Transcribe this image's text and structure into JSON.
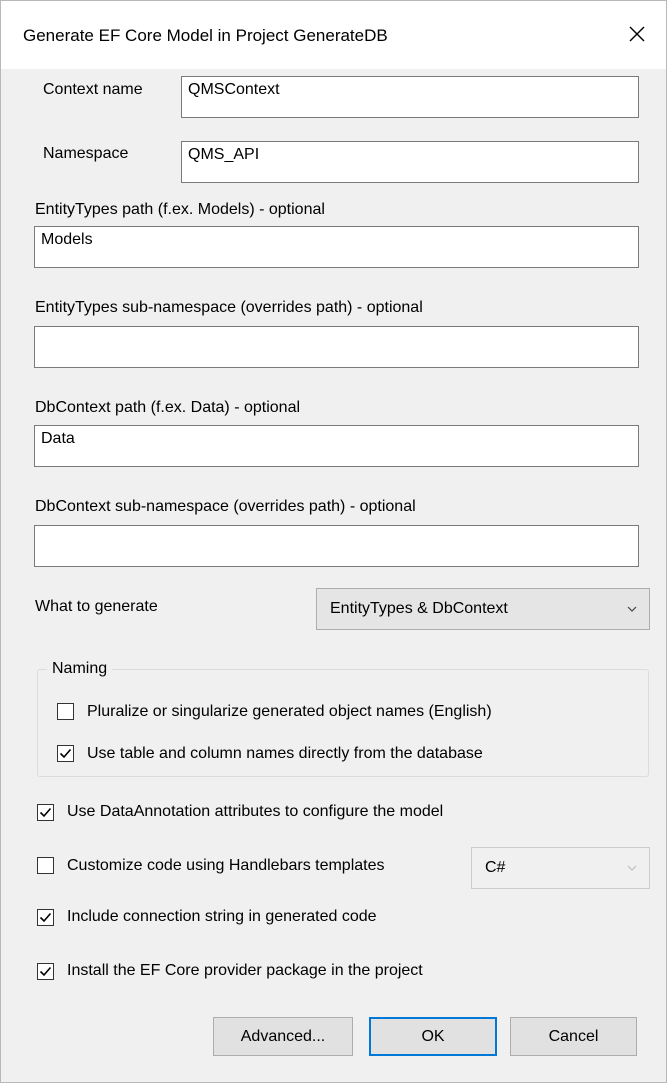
{
  "dialog": {
    "title": "Generate EF Core Model in Project GenerateDB"
  },
  "fields": {
    "context_name": {
      "label": "Context name",
      "value": "QMSContext"
    },
    "namespace": {
      "label": "Namespace",
      "value": "QMS_API"
    },
    "entity_types_path": {
      "label": "EntityTypes path (f.ex. Models) - optional",
      "value": "Models"
    },
    "entity_types_subnamespace": {
      "label": "EntityTypes sub-namespace (overrides path) - optional",
      "value": ""
    },
    "dbcontext_path": {
      "label": "DbContext path (f.ex. Data) - optional",
      "value": "Data"
    },
    "dbcontext_subnamespace": {
      "label": "DbContext sub-namespace (overrides path) - optional",
      "value": ""
    }
  },
  "what_to_generate": {
    "label": "What to generate",
    "selected": "EntityTypes & DbContext"
  },
  "naming": {
    "legend": "Naming",
    "pluralize": {
      "label": "Pluralize or singularize generated object names (English)",
      "checked": false
    },
    "use_db_names": {
      "label": "Use table and column names directly from the database",
      "checked": true
    }
  },
  "options": {
    "data_annotations": {
      "label": "Use DataAnnotation attributes to configure the model",
      "checked": true
    },
    "handlebars": {
      "label": "Customize code using Handlebars templates",
      "checked": false,
      "language": "C#"
    },
    "connection_string": {
      "label": "Include connection string in generated code",
      "checked": true
    },
    "install_provider": {
      "label": "Install the EF Core provider package in the project",
      "checked": true
    }
  },
  "buttons": {
    "advanced": "Advanced...",
    "ok": "OK",
    "cancel": "Cancel"
  },
  "icons": {
    "close": "close-icon",
    "check": "checkmark-icon",
    "dropdown": "chevron-down-icon"
  }
}
